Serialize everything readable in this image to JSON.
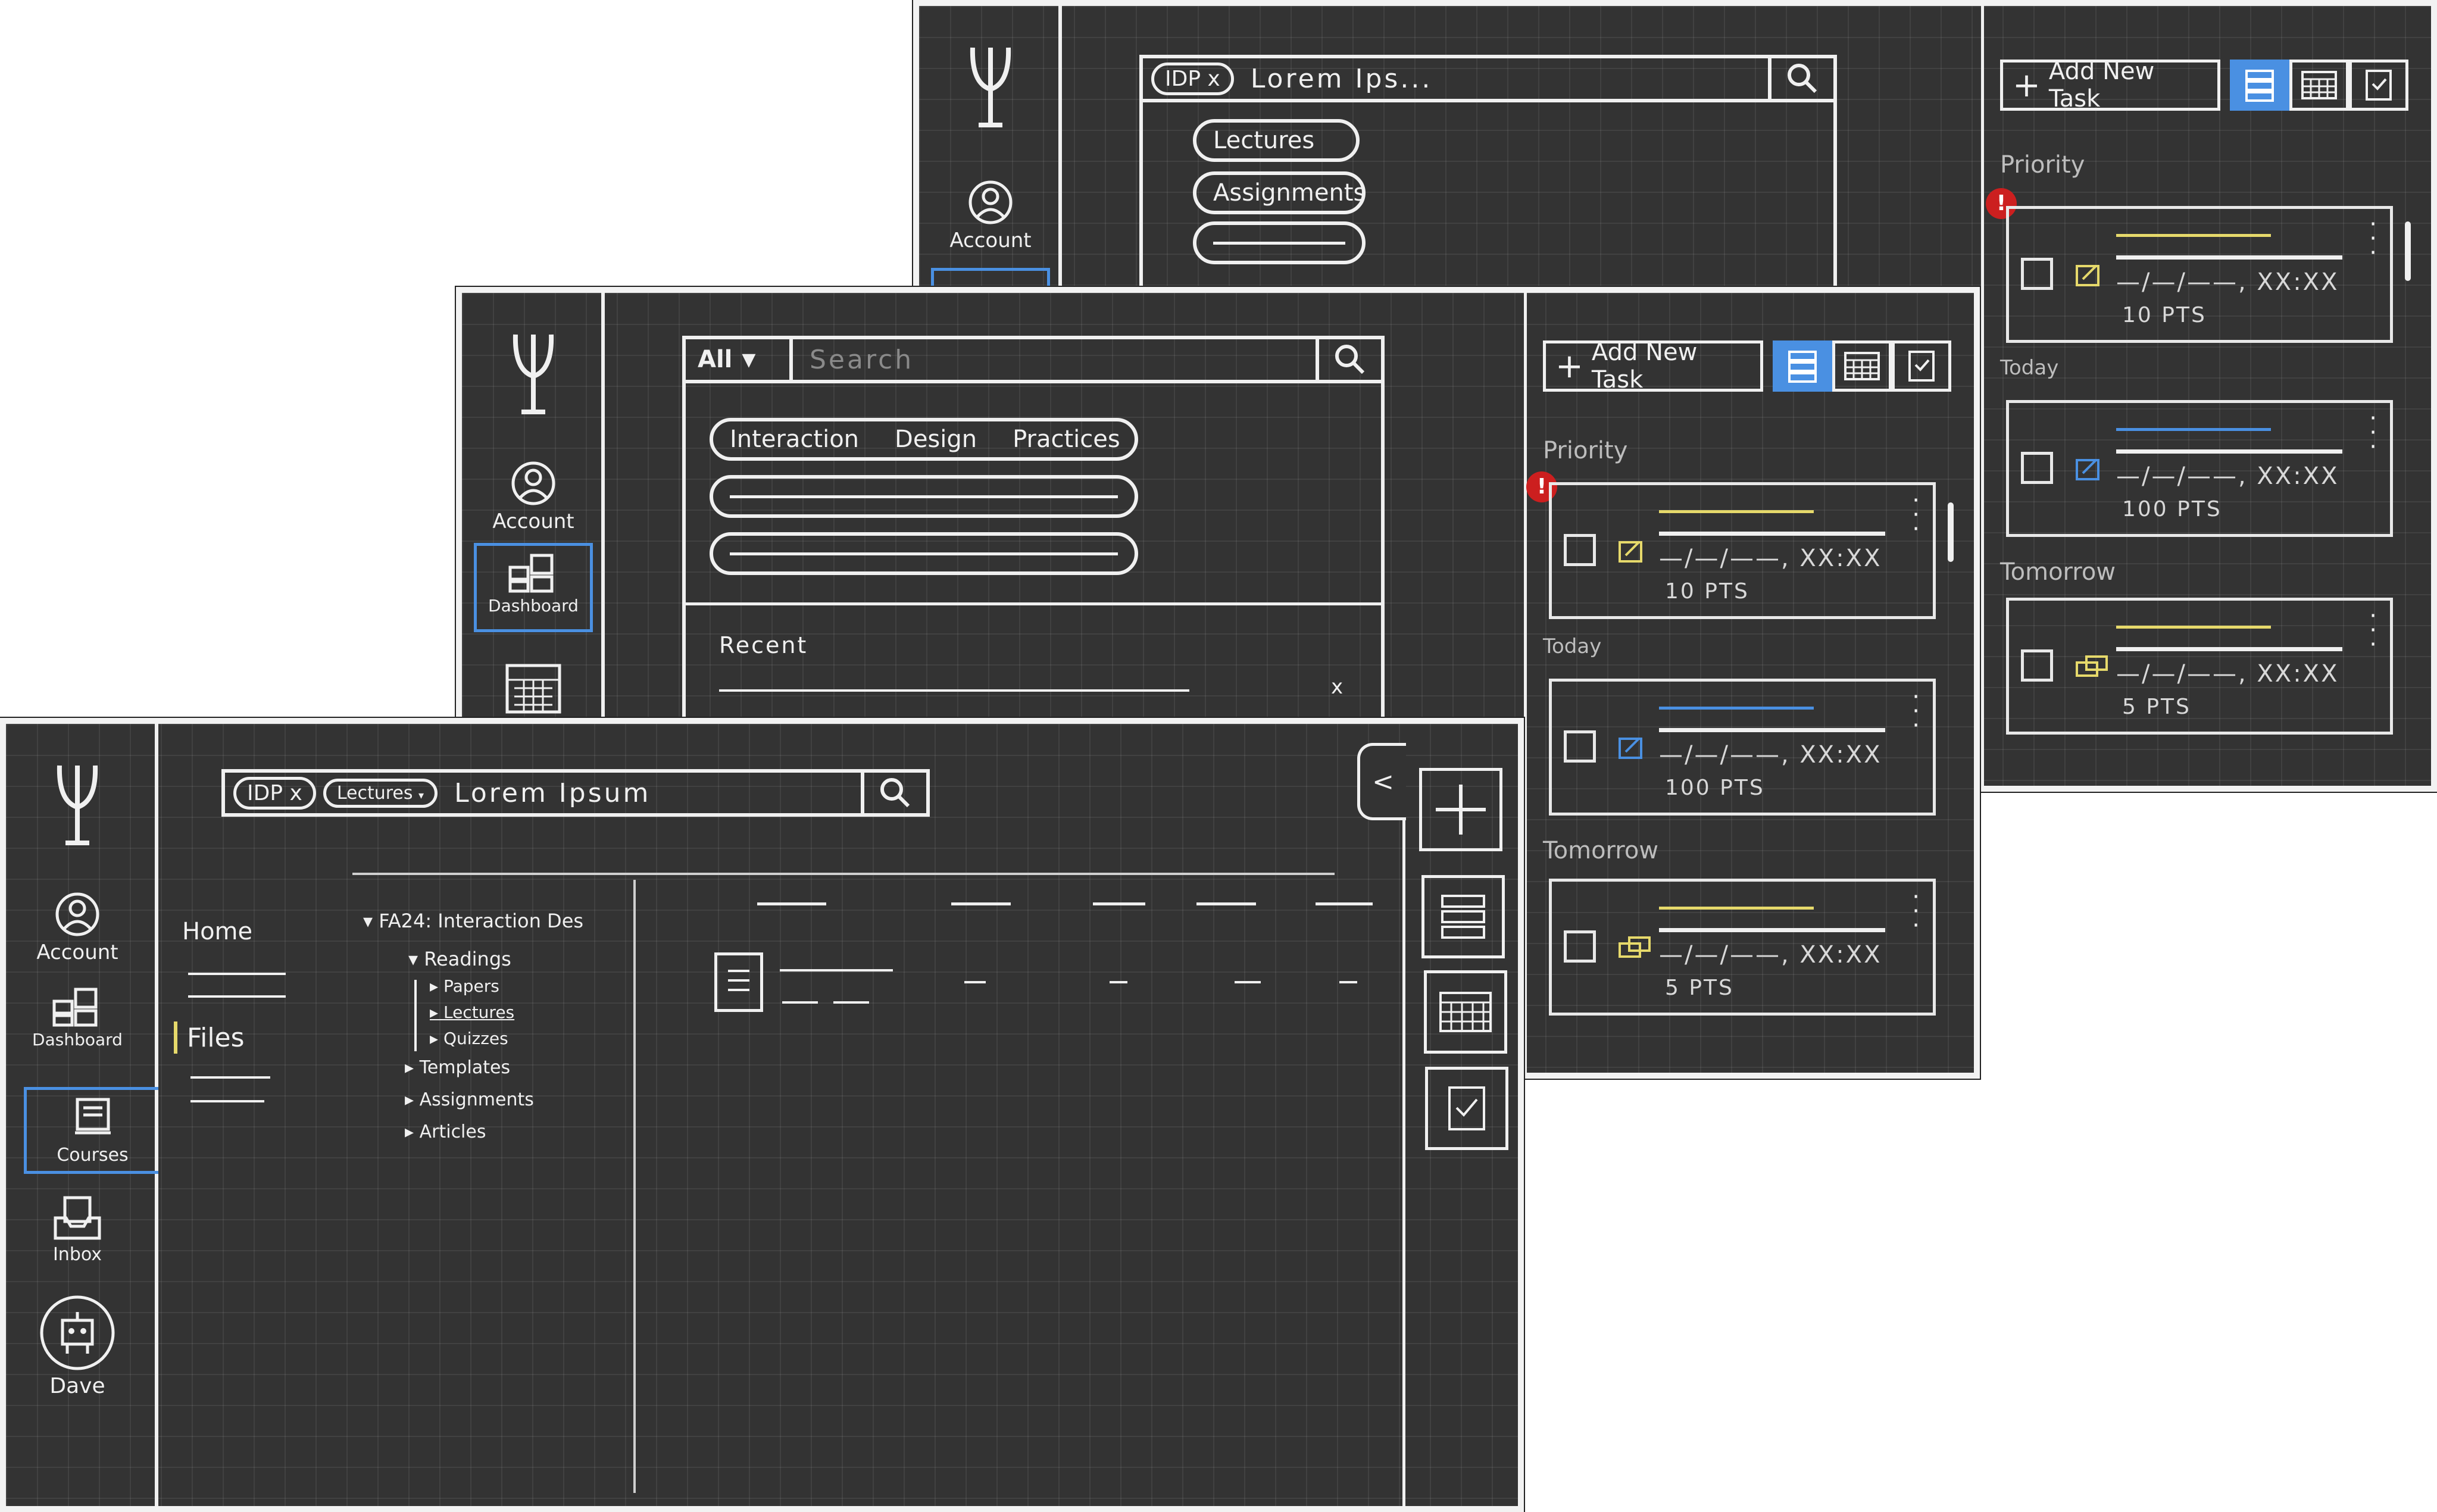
{
  "colors": {
    "background": "#333333",
    "ink": "#f0f0f0",
    "accent_blue": "#4a90e2",
    "accent_yellow": "#e6d96b",
    "warning_red": "#cc1f1f"
  },
  "nav": {
    "account": "Account",
    "dashboard": "Dashboard",
    "courses": "Courses",
    "inbox": "Inbox",
    "dave": "Dave"
  },
  "back": {
    "search": {
      "chip": "IDP",
      "chip_close": "x",
      "query": "Lorem  Ips..."
    },
    "suggestions": [
      "Lectures",
      "Assignments"
    ],
    "panel": {
      "add_task": "Add New Task",
      "sections": {
        "priority": "Priority",
        "today": "Today",
        "tomorrow": "Tomorrow"
      },
      "tasks": [
        {
          "due": "—/—/——, XX:XX",
          "pts": "10 PTS"
        },
        {
          "due": "—/—/——, XX:XX",
          "pts": "100 PTS"
        },
        {
          "due": "—/—/——, XX:XX",
          "pts": "5 PTS"
        }
      ]
    }
  },
  "mid": {
    "search": {
      "filter": "All",
      "filter_icon": "caret-down-icon",
      "placeholder": "Search"
    },
    "suggestions": [
      "Interaction",
      "Design",
      "Practices"
    ],
    "recent_label": "Recent",
    "recent_close": "x",
    "panel": {
      "add_task": "Add New Task",
      "sections": {
        "priority": "Priority",
        "today": "Today",
        "tomorrow": "Tomorrow"
      },
      "tasks": [
        {
          "due": "—/—/——, XX:XX",
          "pts": "10 PTS"
        },
        {
          "due": "—/—/——, XX:XX",
          "pts": "100 PTS"
        },
        {
          "due": "—/—/——, XX:XX",
          "pts": "5 PTS"
        }
      ]
    }
  },
  "front": {
    "search": {
      "chip1": "IDP",
      "chip1_close": "x",
      "chip2": "Lectures",
      "query": "Lorem  Ipsum"
    },
    "course_nav": {
      "home": "Home",
      "files": "Files"
    },
    "tree": {
      "root": "FA24: Interaction Des",
      "readings": "Readings",
      "papers": "Papers",
      "lectures": "Lectures",
      "quizzes": "Quizzes",
      "templates": "Templates",
      "assignments": "Assignments",
      "articles": "Articles"
    },
    "collapse_icon": "<"
  }
}
